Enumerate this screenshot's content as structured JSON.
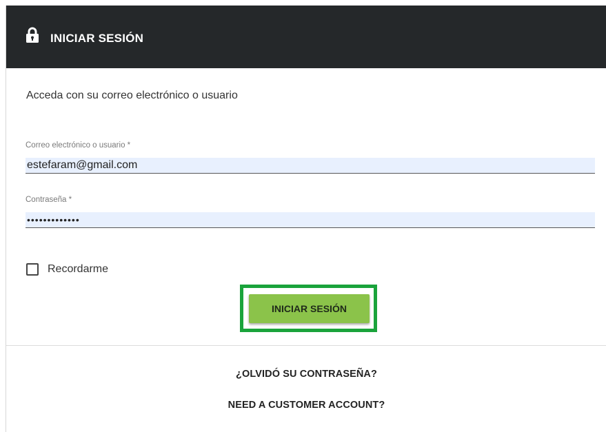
{
  "header": {
    "title": "INICIAR SESIÓN",
    "icon": "lock-icon"
  },
  "intro_text": "Acceda con su correo electrónico o usuario",
  "email_field": {
    "label": "Correo electrónico o usuario *",
    "value": "estefaram@gmail.com"
  },
  "password_field": {
    "label": "Contraseña *",
    "value": "•••••••••••••"
  },
  "remember": {
    "label": "Recordarme",
    "checked": false
  },
  "submit_button": {
    "label": "INICIAR SESIÓN"
  },
  "links": {
    "forgot_password": "¿OLVIDÓ SU CONTRASEÑA?",
    "need_account": "NEED A CUSTOMER ACCOUNT?"
  },
  "colors": {
    "header_bg": "#25282a",
    "button_bg": "#8bc34a",
    "highlight_frame": "#1aa33b",
    "autofill_bg": "#e8f0fe"
  }
}
